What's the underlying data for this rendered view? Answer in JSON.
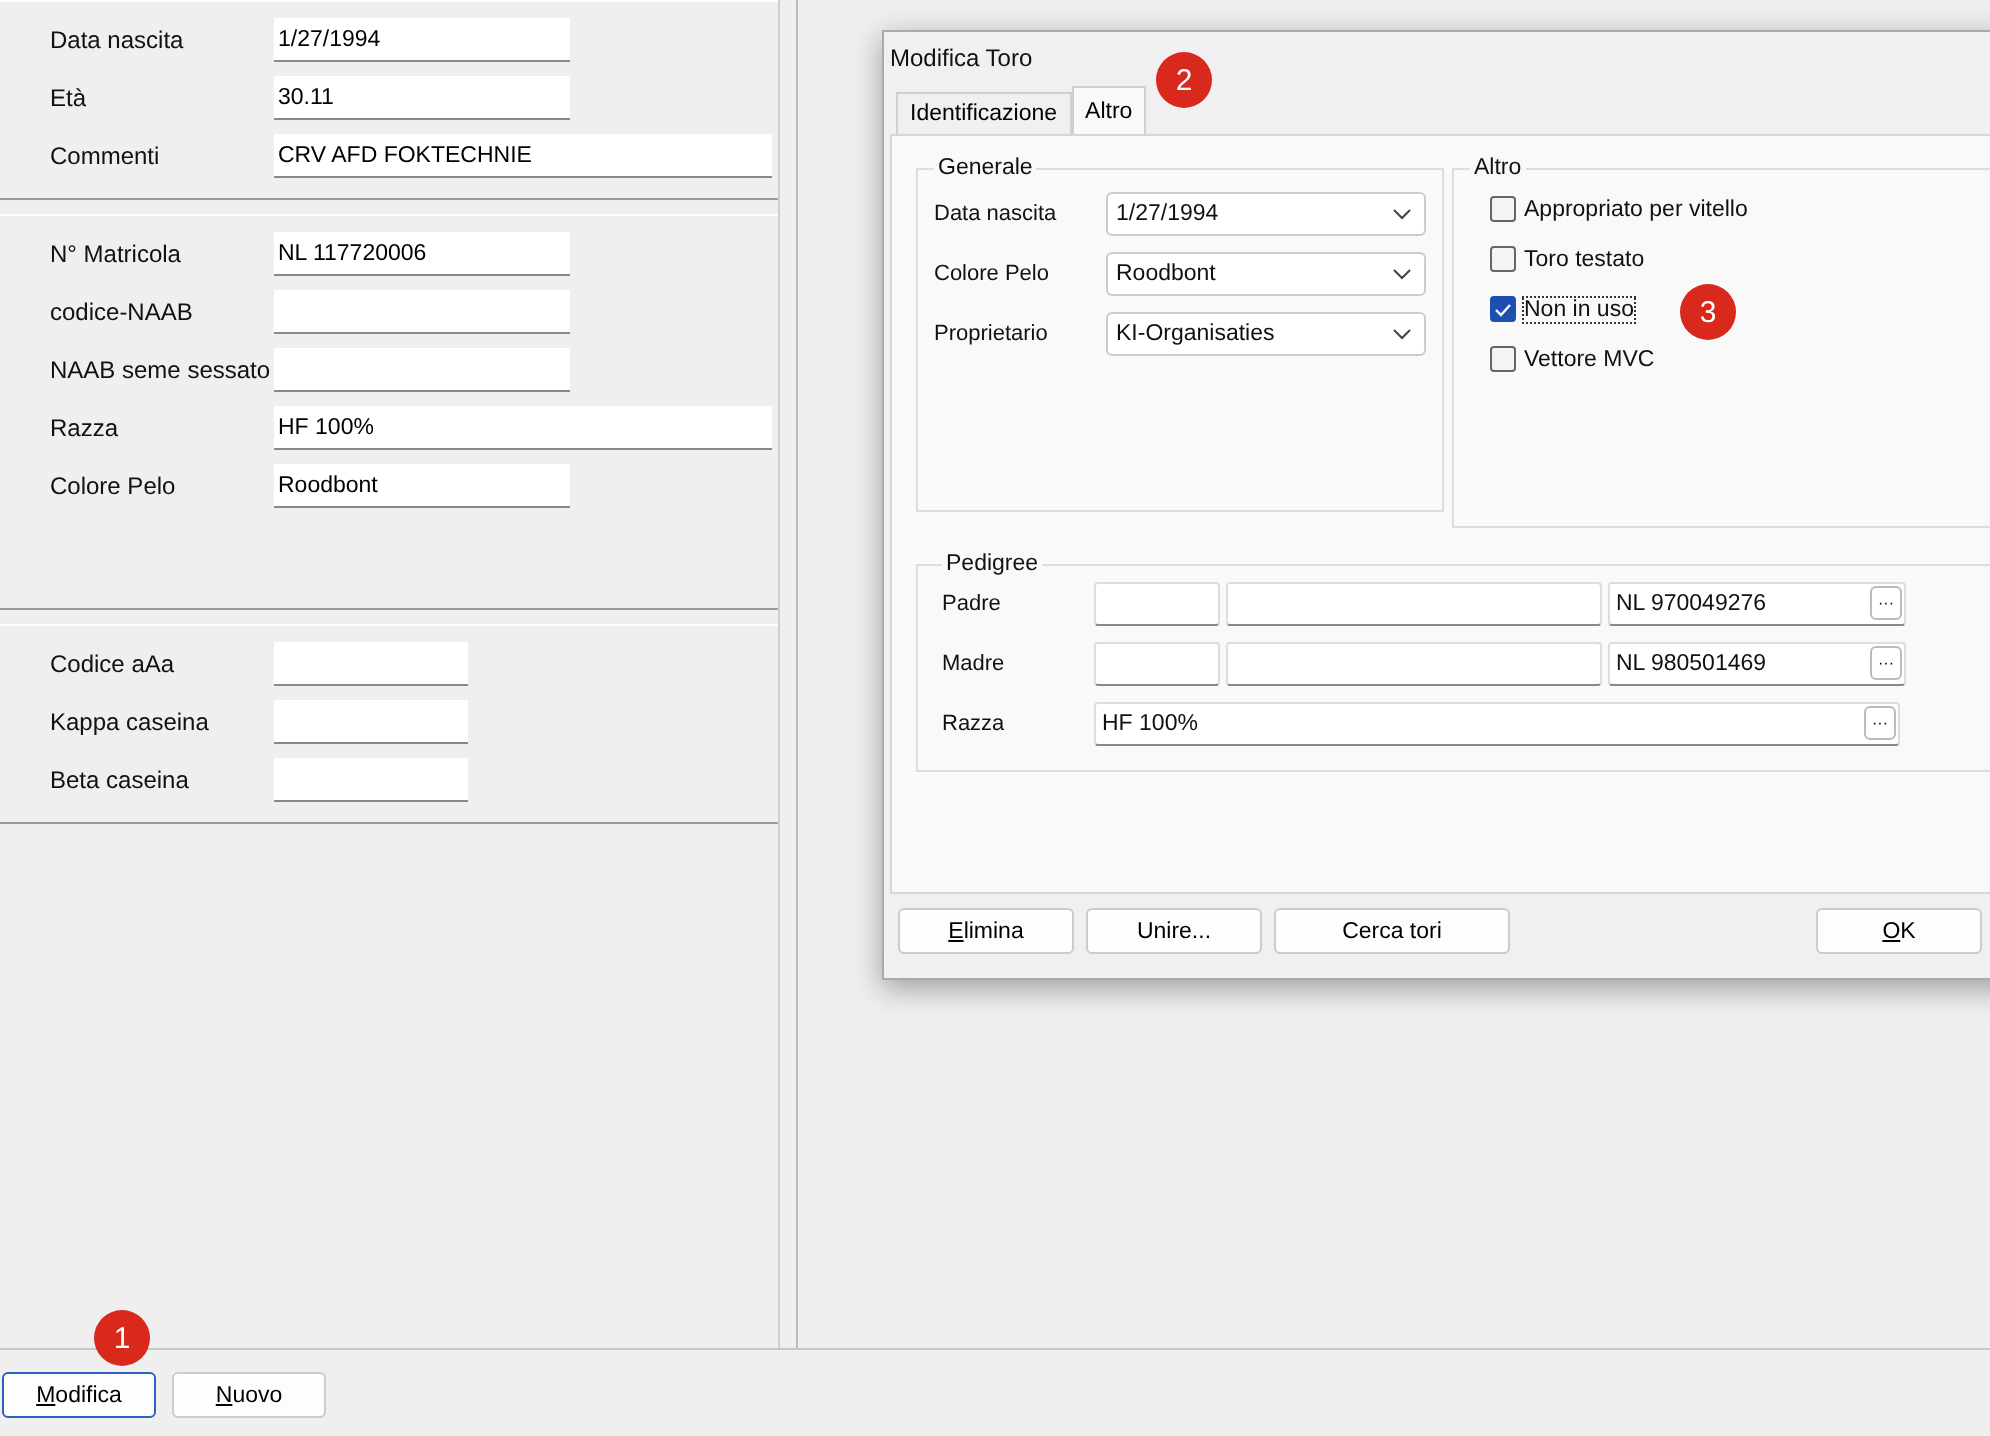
{
  "main_form": {
    "sections": [
      {
        "fields": [
          {
            "label": "Data nascita",
            "value": "1/27/1994",
            "wide": false
          },
          {
            "label": "Età",
            "value": "30.11",
            "wide": false
          },
          {
            "label": "Commenti",
            "value": "CRV AFD FOKTECHNIE",
            "wide": true
          }
        ]
      },
      {
        "fields": [
          {
            "label": "N° Matricola",
            "value": "NL 117720006",
            "wide": false
          },
          {
            "label": "codice-NAAB",
            "wide": false
          },
          {
            "label": "NAAB seme sessato",
            "wide": false
          },
          {
            "label": "Razza",
            "value": "HF 100%",
            "wide": true
          },
          {
            "label": "Colore Pelo",
            "value": "Roodbont",
            "wide": false
          }
        ]
      },
      {
        "fields": [
          {
            "label": "Codice aAa",
            "wide": false
          },
          {
            "label": "Kappa caseina",
            "wide": false
          },
          {
            "label": "Beta caseina",
            "wide": false
          }
        ]
      }
    ]
  },
  "footer_buttons": [
    {
      "label": "Modifica",
      "focused": true,
      "underline_first": true
    },
    {
      "label": "Nuovo",
      "focused": false,
      "underline_first": true
    }
  ],
  "callouts": [
    "1",
    "2",
    "3"
  ],
  "dialog": {
    "title": "Modifica Toro",
    "tabs": [
      {
        "label": "Identificazione",
        "selected": false
      },
      {
        "label": "Altro",
        "selected": true
      }
    ],
    "generale": {
      "title": "Generale",
      "fields": [
        {
          "label": "Data nascita",
          "value": "1/27/1994"
        },
        {
          "label": "Colore Pelo",
          "value": "Roodbont"
        },
        {
          "label": "Proprietario",
          "value": "KI-Organisaties"
        }
      ]
    },
    "altro": {
      "title": "Altro",
      "checkboxes": [
        {
          "label": "Appropriato per vitello",
          "checked": false,
          "focused": false
        },
        {
          "label": "Toro testato",
          "checked": false,
          "focused": false
        },
        {
          "label": "Non in uso",
          "checked": true,
          "focused": true
        },
        {
          "label": "Vettore MVC",
          "checked": false,
          "focused": false
        }
      ]
    },
    "pedigree": {
      "title": "Pedigree",
      "rows": [
        {
          "label": "Padre",
          "kind": "parent",
          "value": "NL 970049276",
          "browse": "···"
        },
        {
          "label": "Madre",
          "kind": "parent",
          "value": "NL 980501469",
          "browse": "···"
        },
        {
          "label": "Razza",
          "kind": "single",
          "value": "HF 100%",
          "browse": "···"
        }
      ]
    },
    "buttons": [
      {
        "label": "Elimina",
        "underline_first": true
      },
      {
        "label": "Unire...",
        "underline_first": false
      },
      {
        "label": "Cerca tori",
        "underline_first": false
      },
      {
        "label": "OK",
        "underline_first": true
      }
    ]
  }
}
